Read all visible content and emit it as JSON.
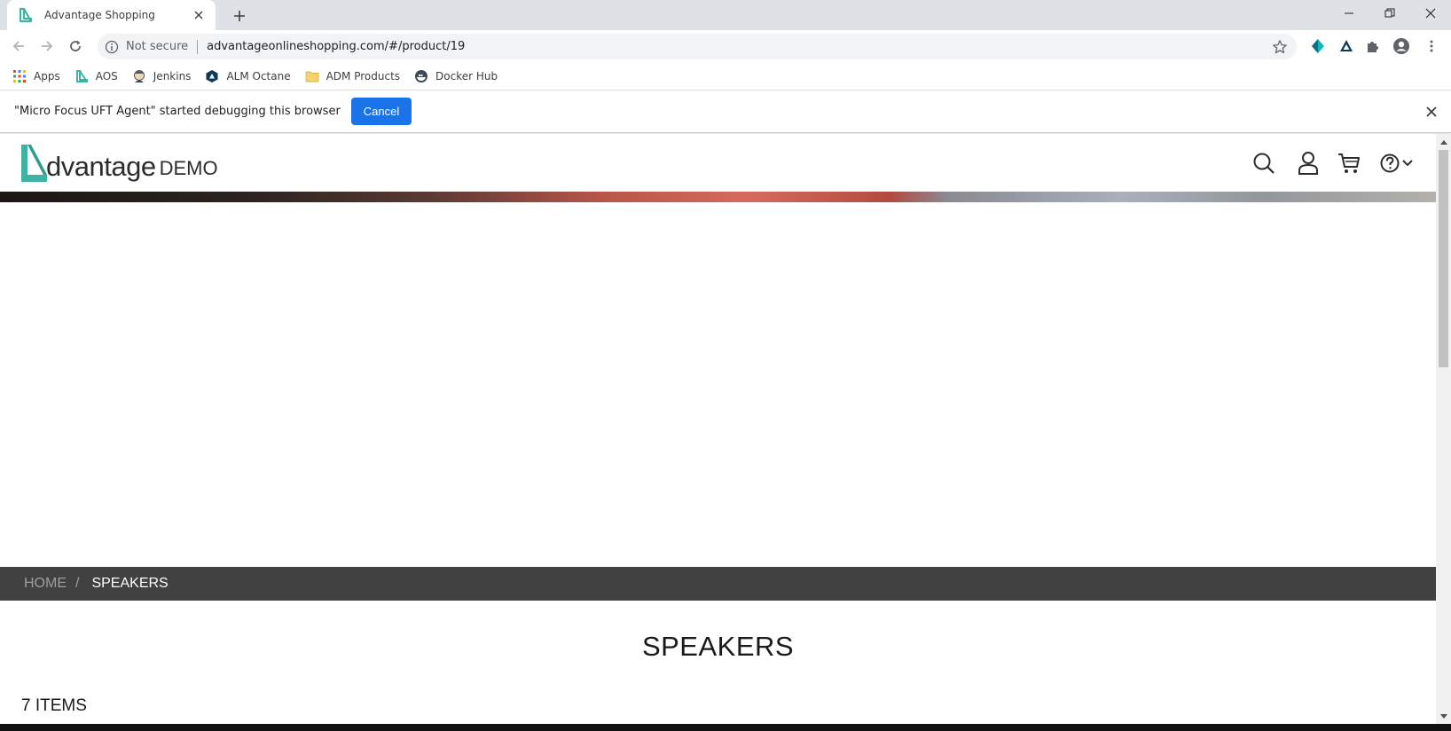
{
  "browser": {
    "tab": {
      "title": "Advantage Shopping",
      "favicon": "aos-logo-icon"
    },
    "address_bar": {
      "security_label": "Not secure",
      "url": "advantageonlineshopping.com/#/product/19"
    },
    "bookmarks": [
      {
        "label": "Apps",
        "icon": "apps-grid-icon"
      },
      {
        "label": "AOS",
        "icon": "aos-logo-icon"
      },
      {
        "label": "Jenkins",
        "icon": "jenkins-icon"
      },
      {
        "label": "ALM Octane",
        "icon": "octane-icon"
      },
      {
        "label": "ADM Products",
        "icon": "folder-icon"
      },
      {
        "label": "Docker Hub",
        "icon": "docker-icon"
      }
    ],
    "infobar": {
      "message": "\"Micro Focus UFT Agent\" started debugging this browser",
      "cancel_label": "Cancel"
    }
  },
  "site": {
    "logo": {
      "word": "dvantage",
      "suffix": "DEMO"
    },
    "header_icons": [
      "search-icon",
      "user-icon",
      "cart-icon",
      "help-icon"
    ],
    "breadcrumb": {
      "home": "HOME",
      "separator": "/",
      "current": "SPEAKERS"
    },
    "category_title": "SPEAKERS",
    "items_count": "7 ITEMS"
  },
  "colors": {
    "brand_teal": "#3fb3a3",
    "breadcrumb_bg": "#414141",
    "cancel_button": "#1a73e8"
  }
}
